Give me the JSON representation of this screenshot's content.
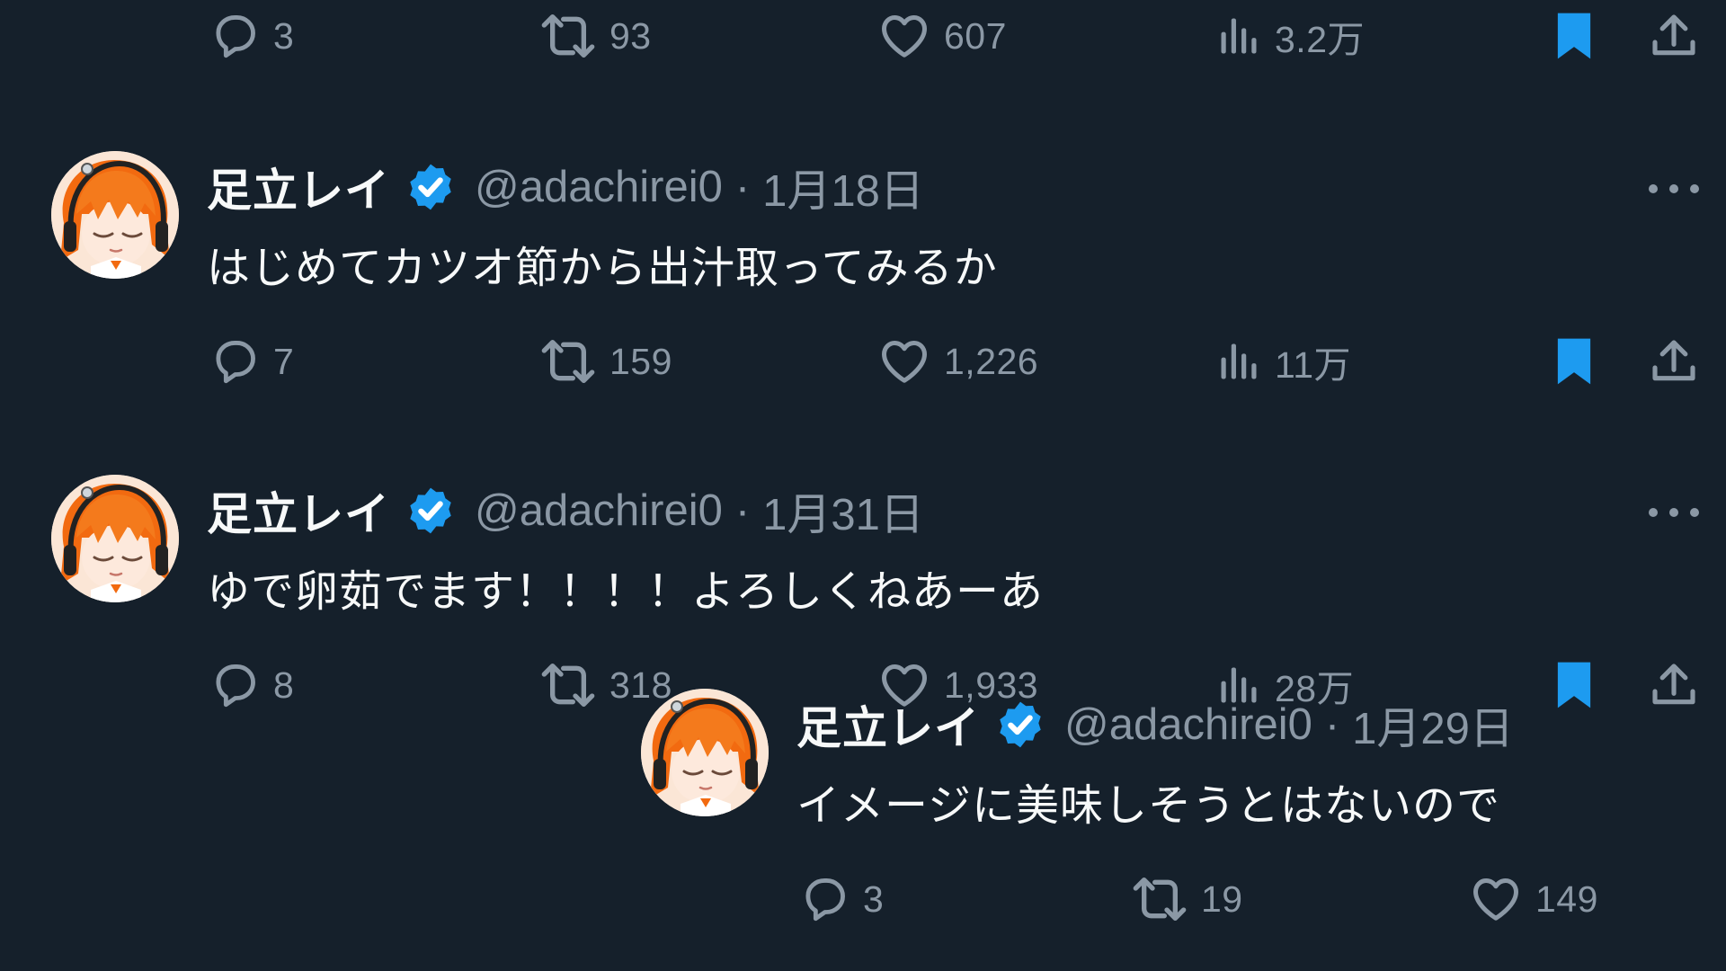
{
  "colors": {
    "background": "#15202b",
    "text_primary": "#f7f9f9",
    "text_secondary": "#8b98a5",
    "accent_blue": "#1d9bf0",
    "avatar_hair": "#f26a10"
  },
  "top_actions": {
    "replies": "3",
    "reposts": "93",
    "likes": "607",
    "views": "3.2万"
  },
  "tweets": [
    {
      "name": "足立レイ",
      "handle": "@adachirei0",
      "separator": "·",
      "date": "1月18日",
      "text": "はじめてカツオ節から出汁取ってみるか",
      "replies": "7",
      "reposts": "159",
      "likes": "1,226",
      "views": "11万"
    },
    {
      "name": "足立レイ",
      "handle": "@adachirei0",
      "separator": "·",
      "date": "1月31日",
      "text": "ゆで卵茹でます！！！！よろしくねあーあ",
      "replies": "8",
      "reposts": "318",
      "likes": "1,933",
      "views": "28万"
    }
  ],
  "overlay_tweet": {
    "name": "足立レイ",
    "handle": "@adachirei0",
    "separator": "·",
    "date": "1月29日",
    "text": "イメージに美味しそうとはないので",
    "replies": "3",
    "reposts": "19",
    "likes": "149"
  },
  "icons": {
    "reply": "reply-icon",
    "repost": "repost-icon",
    "like": "heart-icon",
    "views": "views-icon",
    "bookmark": "bookmark-icon",
    "share": "share-icon",
    "verified": "verified-badge-icon",
    "more": "more-icon"
  }
}
